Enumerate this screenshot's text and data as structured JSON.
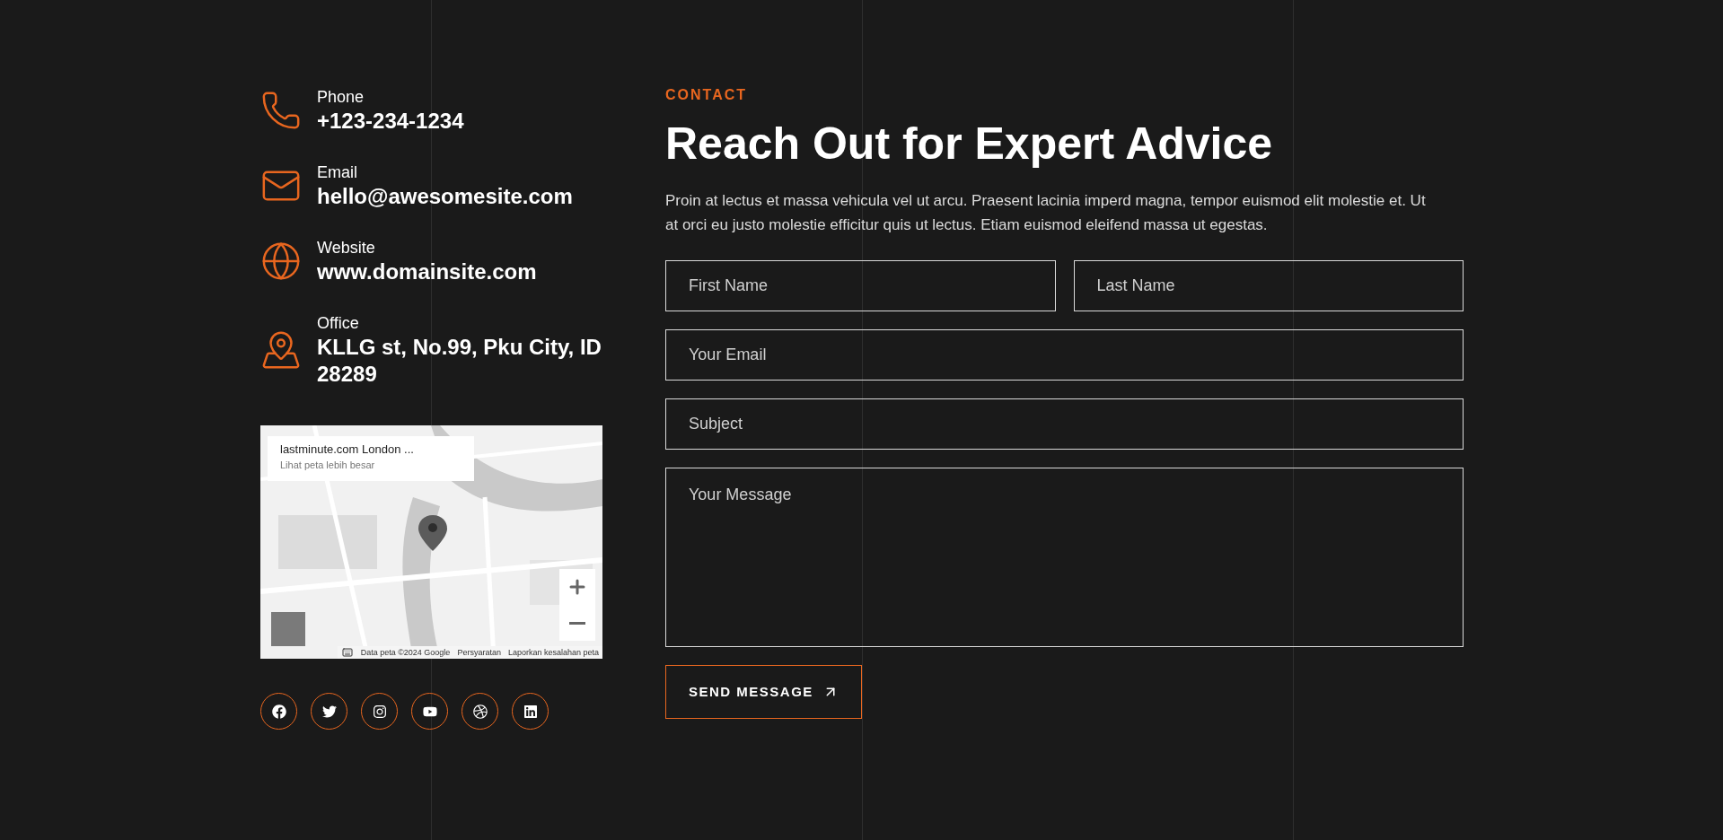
{
  "contact_items": [
    {
      "kind": "phone",
      "label": "Phone",
      "value": "+123-234-1234"
    },
    {
      "kind": "email",
      "label": "Email",
      "value": "hello@awesomesite.com"
    },
    {
      "kind": "website",
      "label": "Website",
      "value": "www.domainsite.com"
    },
    {
      "kind": "office",
      "label": "Office",
      "value": "KLLG st, No.99, Pku City, ID 28289"
    }
  ],
  "map": {
    "kind": "picture",
    "place_title": "lastminute.com London ...",
    "place_link": "Lihat peta lebih besar",
    "attribution": [
      "Data peta ©2024 Google",
      "Persyaratan",
      "Laporkan kesalahan peta"
    ]
  },
  "social_links": [
    {
      "kind": "facebook"
    },
    {
      "kind": "twitter"
    },
    {
      "kind": "instagram"
    },
    {
      "kind": "youtube"
    },
    {
      "kind": "dribbble"
    },
    {
      "kind": "linkedin"
    }
  ],
  "eyebrow": "CONTACT",
  "heading": "Reach Out for Expert Advice",
  "intro": "Proin at lectus et massa vehicula vel ut arcu. Praesent lacinia imperd magna, tempor euismod elit molestie et. Ut at orci eu justo molestie efficitur quis ut lectus. Etiam euismod eleifend massa ut egestas.",
  "form_rows": [
    [
      {
        "kind": "input",
        "placeholder": "First Name"
      },
      {
        "kind": "input",
        "placeholder": "Last Name"
      }
    ],
    [
      {
        "kind": "input",
        "placeholder": "Your Email"
      }
    ],
    [
      {
        "kind": "input",
        "placeholder": "Subject"
      }
    ],
    [
      {
        "kind": "textarea",
        "placeholder": "Your Message"
      }
    ]
  ],
  "submit_label": "SEND MESSAGE"
}
